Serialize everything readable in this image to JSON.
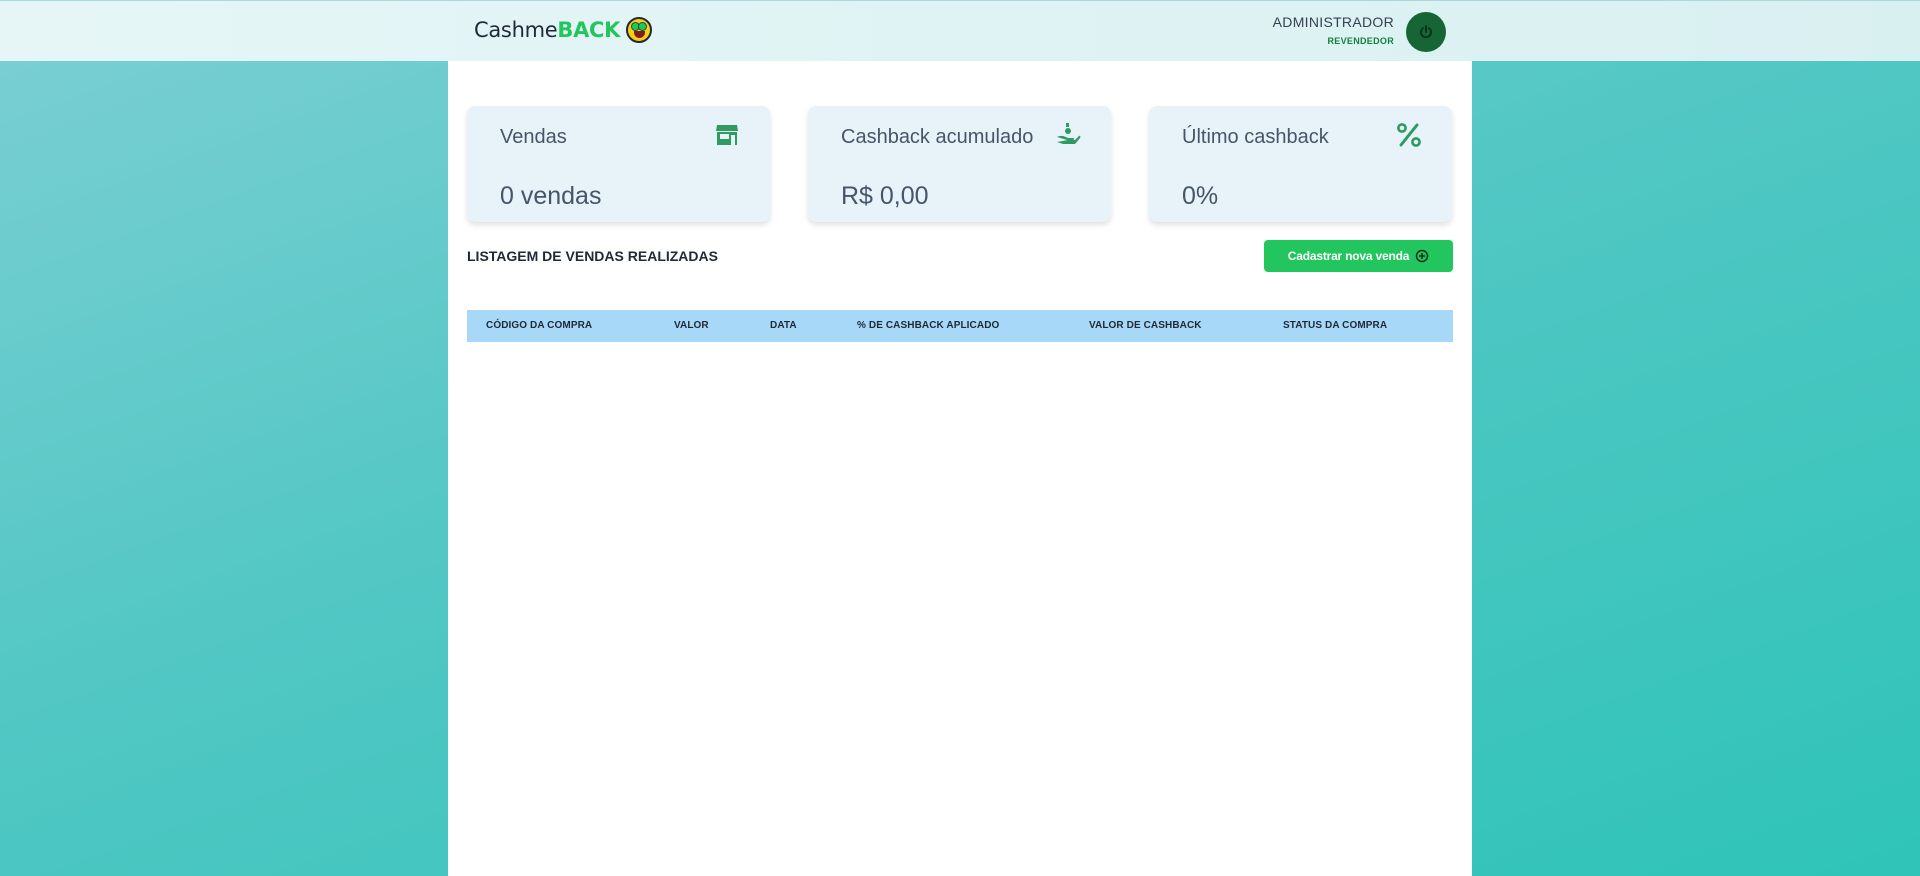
{
  "header": {
    "logo_part1": "Cashme",
    "logo_part2": "BACK",
    "logo_icon": "money-mouth-face-icon",
    "user_name": "ADMINISTRADOR",
    "user_role": "REVENDEDOR",
    "power_icon": "power-icon"
  },
  "cards": [
    {
      "label": "Vendas",
      "value": "0 vendas",
      "icon": "store-icon"
    },
    {
      "label": "Cashback acumulado",
      "value": "R$ 0,00",
      "icon": "hand-coin-icon"
    },
    {
      "label": "Último cashback",
      "value": "0%",
      "icon": "percent-icon"
    }
  ],
  "sales": {
    "title": "LISTAGEM DE VENDAS REALIZADAS",
    "add_button_label": "Cadastrar nova venda",
    "add_button_icon": "plus-circle-icon",
    "columns": [
      "CÓDIGO DA COMPRA",
      "VALOR",
      "DATA",
      "% DE CASHBACK APLICADO",
      "VALOR DE CASHBACK",
      "STATUS DA COMPRA"
    ],
    "rows": []
  },
  "colors": {
    "accent_green": "#22c55e",
    "dark_green": "#166534",
    "table_header": "#a7d8f7",
    "card_bg": "#e8f2f9"
  }
}
